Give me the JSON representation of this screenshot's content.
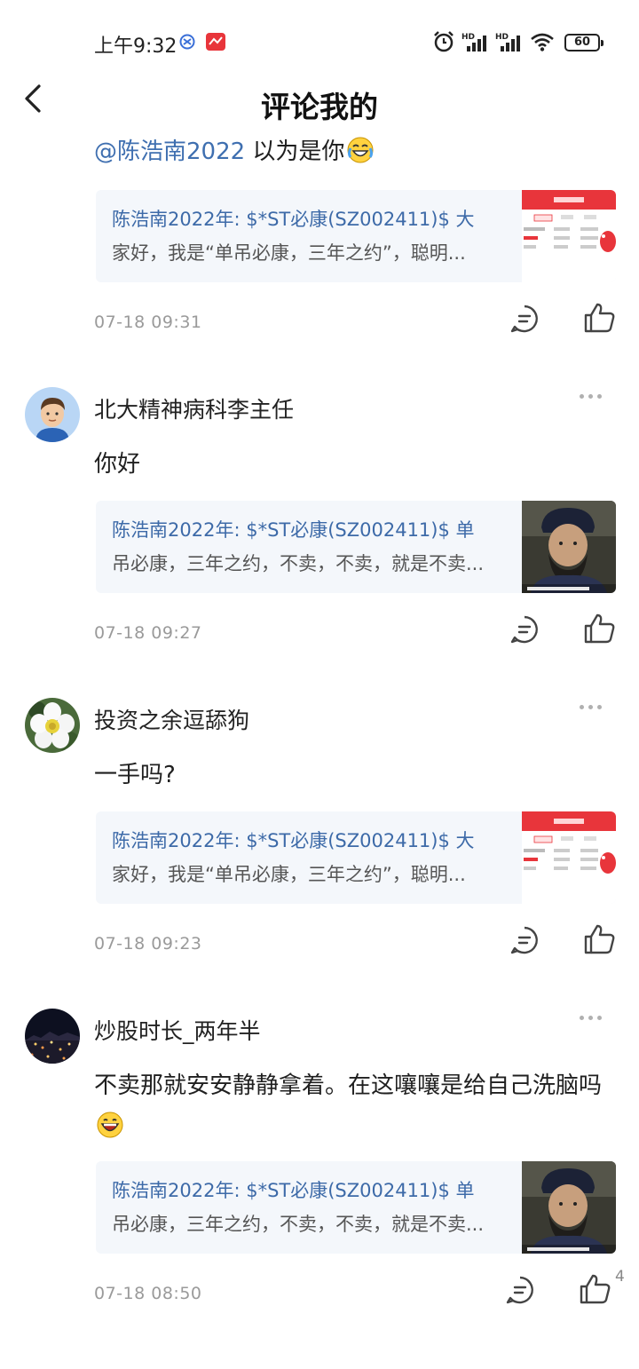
{
  "status_bar": {
    "time": "上午9:32",
    "battery": "60",
    "icons": [
      "vpn-icon",
      "app-notification-icon",
      "alarm-icon",
      "hd-signal-icon",
      "hd-signal-icon",
      "wifi-icon",
      "battery-icon"
    ]
  },
  "header": {
    "title": "评论我的",
    "back_icon": "chevron-left-icon"
  },
  "items": [
    {
      "username": "",
      "mention": "@陈浩南2022",
      "content": " 以为是你",
      "content_emoji": "laughing-tears-emoji",
      "quote": {
        "author": "陈浩南2022年: ",
        "line1_rest": "$*ST必康(SZ002411)$ 大",
        "line2": "家好，我是“单吊必康，三年之约”，聪明..."
      },
      "thumbnail": "app-screenshot",
      "time": "07-18 09:31",
      "likes": ""
    },
    {
      "username": "北大精神病科李主任",
      "content": "你好",
      "quote": {
        "author": "陈浩南2022年: ",
        "line1_rest": "$*ST必康(SZ002411)$ 单",
        "line2": "吊必康，三年之约，不卖，不卖，就是不卖..."
      },
      "thumbnail": "movie-still",
      "time": "07-18 09:27",
      "likes": ""
    },
    {
      "username": "投资之余逗舔狗",
      "content": "一手吗?",
      "quote": {
        "author": "陈浩南2022年: ",
        "line1_rest": "$*ST必康(SZ002411)$ 大",
        "line2": "家好，我是“单吊必康，三年之约”，聪明..."
      },
      "thumbnail": "app-screenshot",
      "time": "07-18 09:23",
      "likes": ""
    },
    {
      "username": "炒股时长_两年半",
      "content": "不卖那就安安静静拿着。在这嚷嚷是给自己洗脑吗",
      "content_emoji": "grinning-emoji",
      "quote": {
        "author": "陈浩南2022年: ",
        "line1_rest": "$*ST必康(SZ002411)$ 单",
        "line2": "吊必康，三年之约，不卖，不卖，就是不卖..."
      },
      "thumbnail": "movie-still",
      "time": "07-18 08:50",
      "likes": "4"
    }
  ],
  "colors": {
    "accent": "#3f6fb0",
    "quote_bg": "#f4f7fb",
    "timestamp": "#9a9a9a",
    "app_red": "#e8353b"
  }
}
